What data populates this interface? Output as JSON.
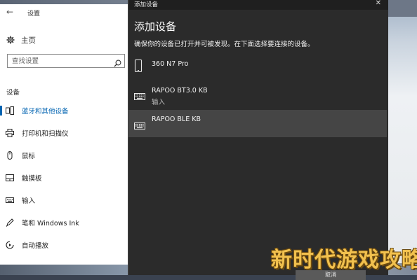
{
  "settings": {
    "title": "设置",
    "home_label": "主页",
    "search_placeholder": "查找设置",
    "section_label": "设备",
    "nav_items": [
      {
        "label": "蓝牙和其他设备",
        "icon": "bluetooth-devices-icon",
        "active": true
      },
      {
        "label": "打印机和扫描仪",
        "icon": "printer-icon",
        "active": false
      },
      {
        "label": "鼠标",
        "icon": "mouse-icon",
        "active": false
      },
      {
        "label": "触摸板",
        "icon": "touchpad-icon",
        "active": false
      },
      {
        "label": "输入",
        "icon": "keyboard-icon",
        "active": false
      },
      {
        "label": "笔和 Windows Ink",
        "icon": "pen-icon",
        "active": false
      },
      {
        "label": "自动播放",
        "icon": "autoplay-icon",
        "active": false
      }
    ]
  },
  "dialog": {
    "window_title": "添加设备",
    "heading": "添加设备",
    "instruction": "确保你的设备已打开并可被发现。在下面选择要连接的设备。",
    "devices": [
      {
        "name": "360 N7 Pro",
        "sub": "",
        "icon": "phone-icon"
      },
      {
        "name": "RAPOO BT3.0 KB",
        "sub": "输入",
        "icon": "keyboard-icon"
      },
      {
        "name": "RAPOO BLE KB",
        "sub": "",
        "icon": "keyboard-icon",
        "selected": true
      }
    ],
    "cancel_label": "取消",
    "close_glyph": "✕"
  },
  "watermark": "新时代游戏攻略",
  "colors": {
    "accent": "#0063b1",
    "dialog_bg": "#2b2b2b",
    "selected_row": "#454545"
  }
}
